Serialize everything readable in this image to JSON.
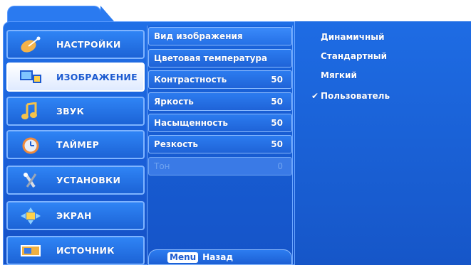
{
  "categories": [
    {
      "label": "НАСТРОЙКИ",
      "icon": "settings-satellite-icon",
      "active": false
    },
    {
      "label": "ИЗОБРАЖЕНИЕ",
      "icon": "picture-icon",
      "active": true
    },
    {
      "label": "ЗВУК",
      "icon": "music-note-icon",
      "active": false
    },
    {
      "label": "ТАЙМЕР",
      "icon": "clock-icon",
      "active": false
    },
    {
      "label": "УСТАНОВКИ",
      "icon": "tools-icon",
      "active": false
    },
    {
      "label": "ЭКРАН",
      "icon": "screen-position-icon",
      "active": false
    },
    {
      "label": "ИСТОЧНИК",
      "icon": "input-source-icon",
      "active": false
    }
  ],
  "settings": {
    "picture_mode_label": "Вид изображения",
    "color_temp_label": "Цветовая температура",
    "rows": [
      {
        "label": "Контрастность",
        "value": "50"
      },
      {
        "label": "Яркость",
        "value": "50"
      },
      {
        "label": "Насыщенность",
        "value": "50"
      },
      {
        "label": "Резкость",
        "value": "50"
      },
      {
        "label": "Тон",
        "value": "0"
      }
    ]
  },
  "footer": {
    "menu_key": "Menu",
    "back_label": "Назад"
  },
  "picture_modes": [
    {
      "label": "Динамичный",
      "selected": false
    },
    {
      "label": "Стандартный",
      "selected": false
    },
    {
      "label": "Мягкий",
      "selected": false
    },
    {
      "label": "Пользователь",
      "selected": true
    }
  ],
  "check_mark": "✔",
  "colors": {
    "accent": "#1a5fd8",
    "highlight": "#ffffff",
    "disabled_text": "#6fa3f0"
  }
}
